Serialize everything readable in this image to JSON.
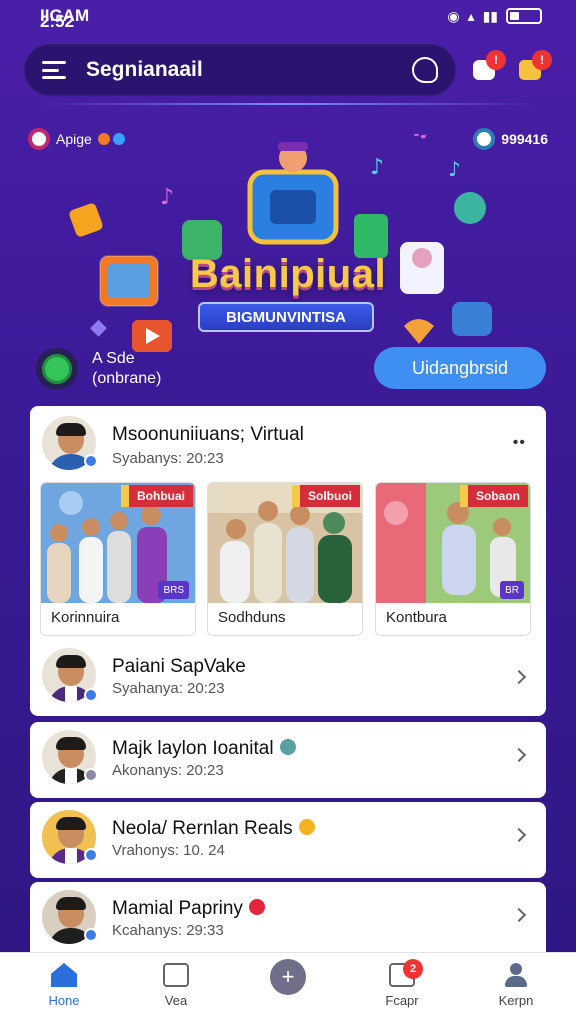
{
  "status_bar": {
    "carrier": "IIGAM",
    "time": "2:52"
  },
  "header": {
    "title": "Segnianaail",
    "chat_badge": "!",
    "gift_badge": "!"
  },
  "hero": {
    "left_chip": "Apige",
    "right_chip": "999416",
    "title": "Bainipiual",
    "ribbon": "BIGMUNVINTISA",
    "user_name": "A Sde",
    "user_sub": "(onbrane)",
    "cta": "Uidangbrsid"
  },
  "post": {
    "title": "Msoonuniiuans; Virtual",
    "subtitle": "Syabanys: 20:23",
    "thumbnails": [
      {
        "tag": "Bohbuai",
        "label": "Korinnuira",
        "vid": "BRS"
      },
      {
        "tag": "Solbuoi",
        "label": "Sodhduns",
        "vid": ""
      },
      {
        "tag": "Sobaon",
        "label": "Kontbura",
        "vid": "BR"
      }
    ]
  },
  "list": [
    {
      "title": "Paiani SapVake",
      "subtitle": "Syahanya: 20:23",
      "emoji_color": ""
    },
    {
      "title": "Majk laylon Ioanital",
      "subtitle": "Akonanys: 20:23",
      "emoji_color": "#5aa0a0"
    },
    {
      "title": "Neola/ Rernlan Reals",
      "subtitle": "Vrahonys: 10. 24",
      "emoji_color": "#f5b321"
    },
    {
      "title": "Mamial Papriny",
      "subtitle": "Kcahanys: 29:33",
      "emoji_color": "#e3243a"
    }
  ],
  "nav": {
    "items": [
      {
        "label": "Hone",
        "icon": "home-icon",
        "active": true
      },
      {
        "label": "Vea",
        "icon": "video-icon"
      },
      {
        "label": "+",
        "icon": "plus-icon"
      },
      {
        "label": "Fcapr",
        "icon": "image-icon",
        "badge": "2"
      },
      {
        "label": "Kerpn",
        "icon": "user-icon"
      }
    ]
  },
  "colors": {
    "accent": "#3f8ef2",
    "bg_top": "#4a1fa8",
    "badge": "#e33333",
    "title_gold": "#f7c948"
  }
}
